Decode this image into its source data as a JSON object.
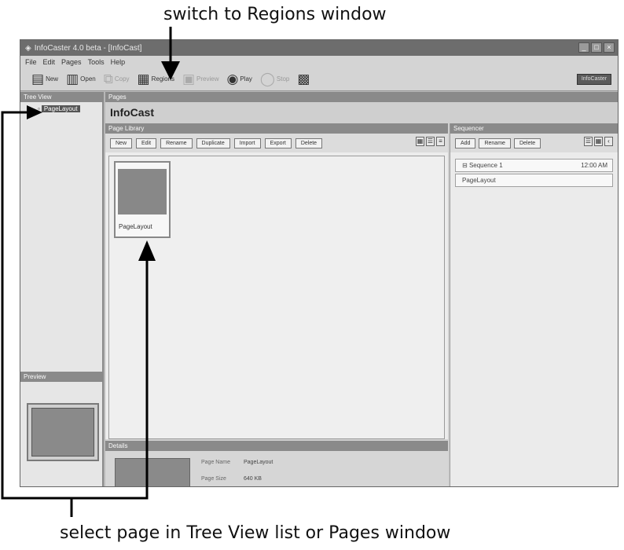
{
  "captions": {
    "top": "switch to Regions window",
    "bottom": "select page in Tree View list or Pages window"
  },
  "window": {
    "title": "InfoCaster 4.0 beta - [InfoCast]",
    "controls": [
      "_",
      "□",
      "×"
    ]
  },
  "menu": [
    "File",
    "Edit",
    "Pages",
    "Tools",
    "Help"
  ],
  "toolbar": {
    "buttons": [
      {
        "label": "New",
        "icon": "new-page-icon",
        "glyph": "▤",
        "enabled": true
      },
      {
        "label": "Open",
        "icon": "open-icon",
        "glyph": "▥",
        "enabled": true
      },
      {
        "label": "Copy",
        "icon": "copy-icon",
        "glyph": "⧉",
        "enabled": false
      },
      {
        "label": "Regions",
        "icon": "regions-icon",
        "glyph": "▦",
        "enabled": true
      },
      {
        "label": "Preview",
        "icon": "preview-icon",
        "glyph": "▣",
        "enabled": false
      },
      {
        "label": "Play",
        "icon": "play-icon",
        "glyph": "◉",
        "enabled": true
      },
      {
        "label": "Stop",
        "icon": "stop-icon",
        "glyph": "◯",
        "enabled": false
      },
      {
        "label": "",
        "icon": "publish-icon",
        "glyph": "▩",
        "enabled": true
      }
    ],
    "right_badge": "InfoCaster"
  },
  "tree_view": {
    "header": "Tree View",
    "selected_item": "PageLayout"
  },
  "preview": {
    "header": "Preview"
  },
  "pages": {
    "header": "Pages",
    "title": "InfoCast"
  },
  "page_library": {
    "header": "Page Library",
    "buttons": [
      "New",
      "Edit",
      "Rename",
      "Duplicate",
      "Import",
      "Export",
      "Delete"
    ],
    "thumbnail_label": "PageLayout"
  },
  "sequencer": {
    "header": "Sequencer",
    "buttons": [
      "Add",
      "Rename",
      "Delete"
    ],
    "sequence_name": "Sequence 1",
    "sequence_time": "12:00 AM",
    "page_entry": "PageLayout"
  },
  "details": {
    "header": "Details",
    "fields": [
      {
        "key": "Page Name",
        "value": "PageLayout"
      },
      {
        "key": "Page Size",
        "value": "640 KB"
      }
    ]
  },
  "colors": {
    "header_gray": "#8a8a8a",
    "titlebar": "#6d6d6d",
    "annotation_black": "#000000"
  }
}
